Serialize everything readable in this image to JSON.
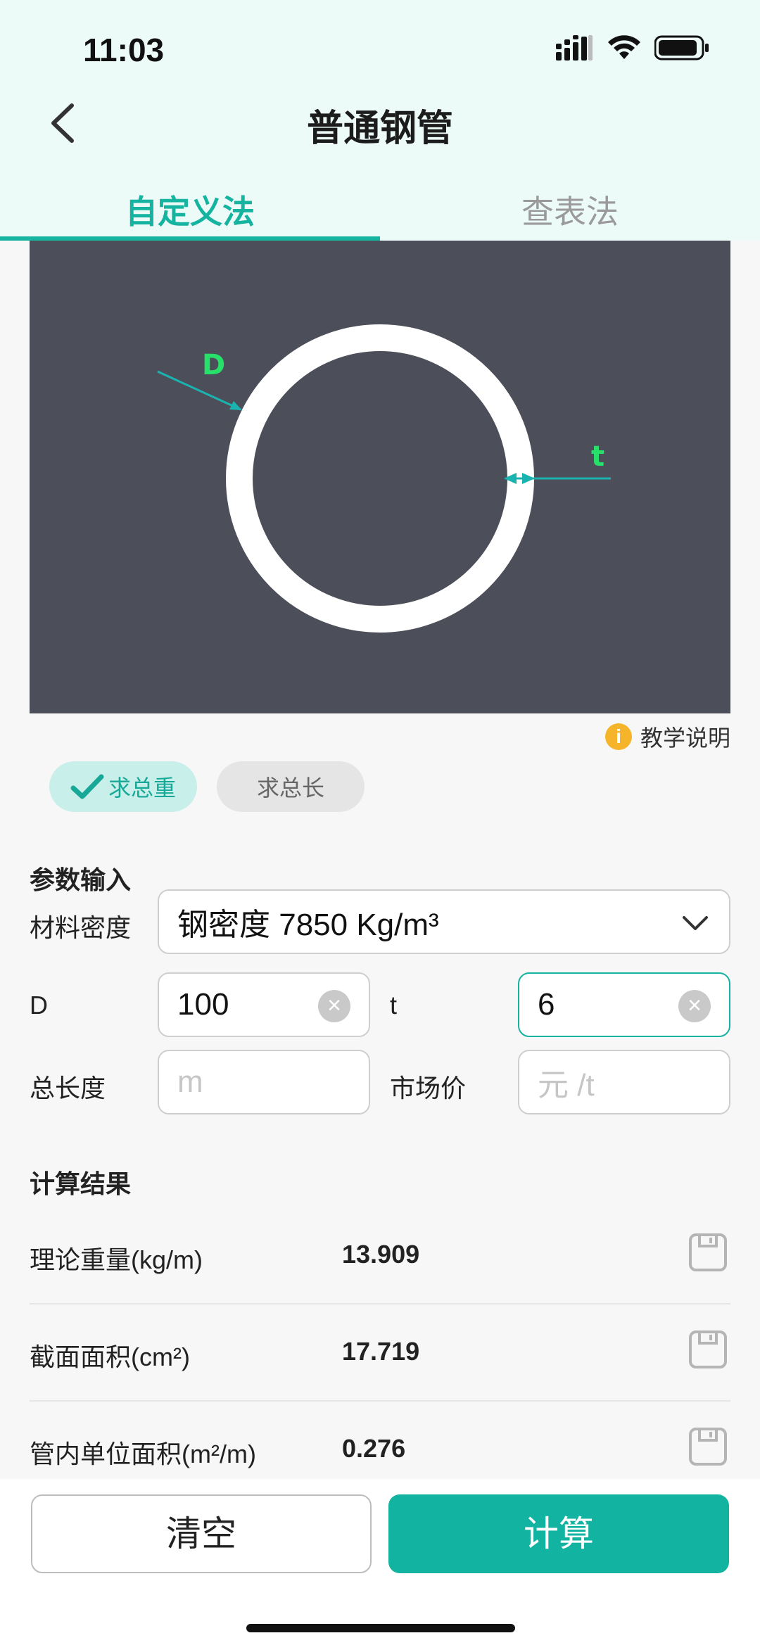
{
  "status": {
    "time": "11:03"
  },
  "nav": {
    "title": "普通钢管"
  },
  "tabs": [
    {
      "label": "自定义法",
      "active": true
    },
    {
      "label": "查表法",
      "active": false
    }
  ],
  "diagram": {
    "label_d": "D",
    "label_t": "t"
  },
  "help": {
    "icon": "i",
    "label": "教学说明"
  },
  "modes": {
    "weight": "求总重",
    "length": "求总长"
  },
  "params": {
    "title": "参数输入",
    "density_label": "材料密度",
    "density_value": "钢密度  7850  Kg/m³",
    "d_label": "D",
    "d_value": "100",
    "t_label": "t",
    "t_value": "6",
    "length_label": "总长度",
    "length_placeholder": "m",
    "price_label": "市场价",
    "price_placeholder": "元 /t"
  },
  "results": {
    "title": "计算结果",
    "rows": [
      {
        "label": "理论重量(kg/m)",
        "value": "13.909"
      },
      {
        "label": "截面面积(cm²)",
        "value": "17.719"
      },
      {
        "label": "管内单位面积(m²/m)",
        "value": "0.276"
      }
    ]
  },
  "buttons": {
    "clear": "清空",
    "calculate": "计算"
  },
  "colors": {
    "accent": "#12b3a0",
    "header_bg": "#ecfbf8",
    "diagram_bg": "#4c4f5a",
    "help_icon": "#f5b42a"
  }
}
